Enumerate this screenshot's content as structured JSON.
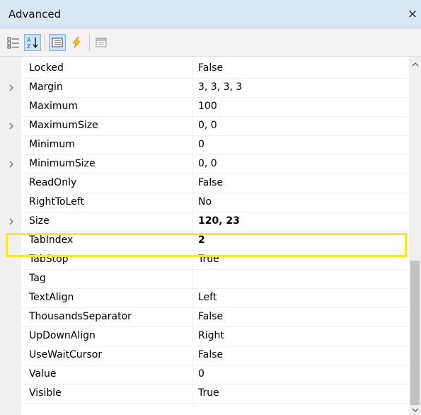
{
  "window": {
    "title": "Advanced",
    "close_label": "×"
  },
  "toolbar": {
    "buttons": [
      {
        "name": "categorized",
        "icon": "categorized-icon"
      },
      {
        "name": "alphabetical",
        "icon": "sort-az-icon",
        "active": true
      },
      {
        "name": "properties",
        "icon": "properties-icon",
        "active": true
      },
      {
        "name": "events",
        "icon": "events-lightning-icon"
      },
      {
        "name": "property-pages",
        "icon": "property-pages-icon"
      }
    ]
  },
  "properties": [
    {
      "name": "Locked",
      "value": "False",
      "expandable": false,
      "bold": false
    },
    {
      "name": "Margin",
      "value": "3, 3, 3, 3",
      "expandable": true,
      "bold": false
    },
    {
      "name": "Maximum",
      "value": "100",
      "expandable": false,
      "bold": false
    },
    {
      "name": "MaximumSize",
      "value": "0, 0",
      "expandable": true,
      "bold": false
    },
    {
      "name": "Minimum",
      "value": "0",
      "expandable": false,
      "bold": false
    },
    {
      "name": "MinimumSize",
      "value": "0, 0",
      "expandable": true,
      "bold": false
    },
    {
      "name": "ReadOnly",
      "value": "False",
      "expandable": false,
      "bold": false
    },
    {
      "name": "RightToLeft",
      "value": "No",
      "expandable": false,
      "bold": false
    },
    {
      "name": "Size",
      "value": "120, 23",
      "expandable": true,
      "bold": true
    },
    {
      "name": "TabIndex",
      "value": "2",
      "expandable": false,
      "bold": true,
      "highlighted": true
    },
    {
      "name": "TabStop",
      "value": "True",
      "expandable": false,
      "bold": false
    },
    {
      "name": "Tag",
      "value": "",
      "expandable": false,
      "bold": false
    },
    {
      "name": "TextAlign",
      "value": "Left",
      "expandable": false,
      "bold": false
    },
    {
      "name": "ThousandsSeparator",
      "value": "False",
      "expandable": false,
      "bold": false
    },
    {
      "name": "UpDownAlign",
      "value": "Right",
      "expandable": false,
      "bold": false
    },
    {
      "name": "UseWaitCursor",
      "value": "False",
      "expandable": false,
      "bold": false
    },
    {
      "name": "Value",
      "value": "0",
      "expandable": false,
      "bold": false
    },
    {
      "name": "Visible",
      "value": "True",
      "expandable": false,
      "bold": false
    }
  ],
  "colors": {
    "highlight_border": "#fbe535",
    "title_bg": "#d9e6f3",
    "active_button_bg": "#cde3f7"
  }
}
